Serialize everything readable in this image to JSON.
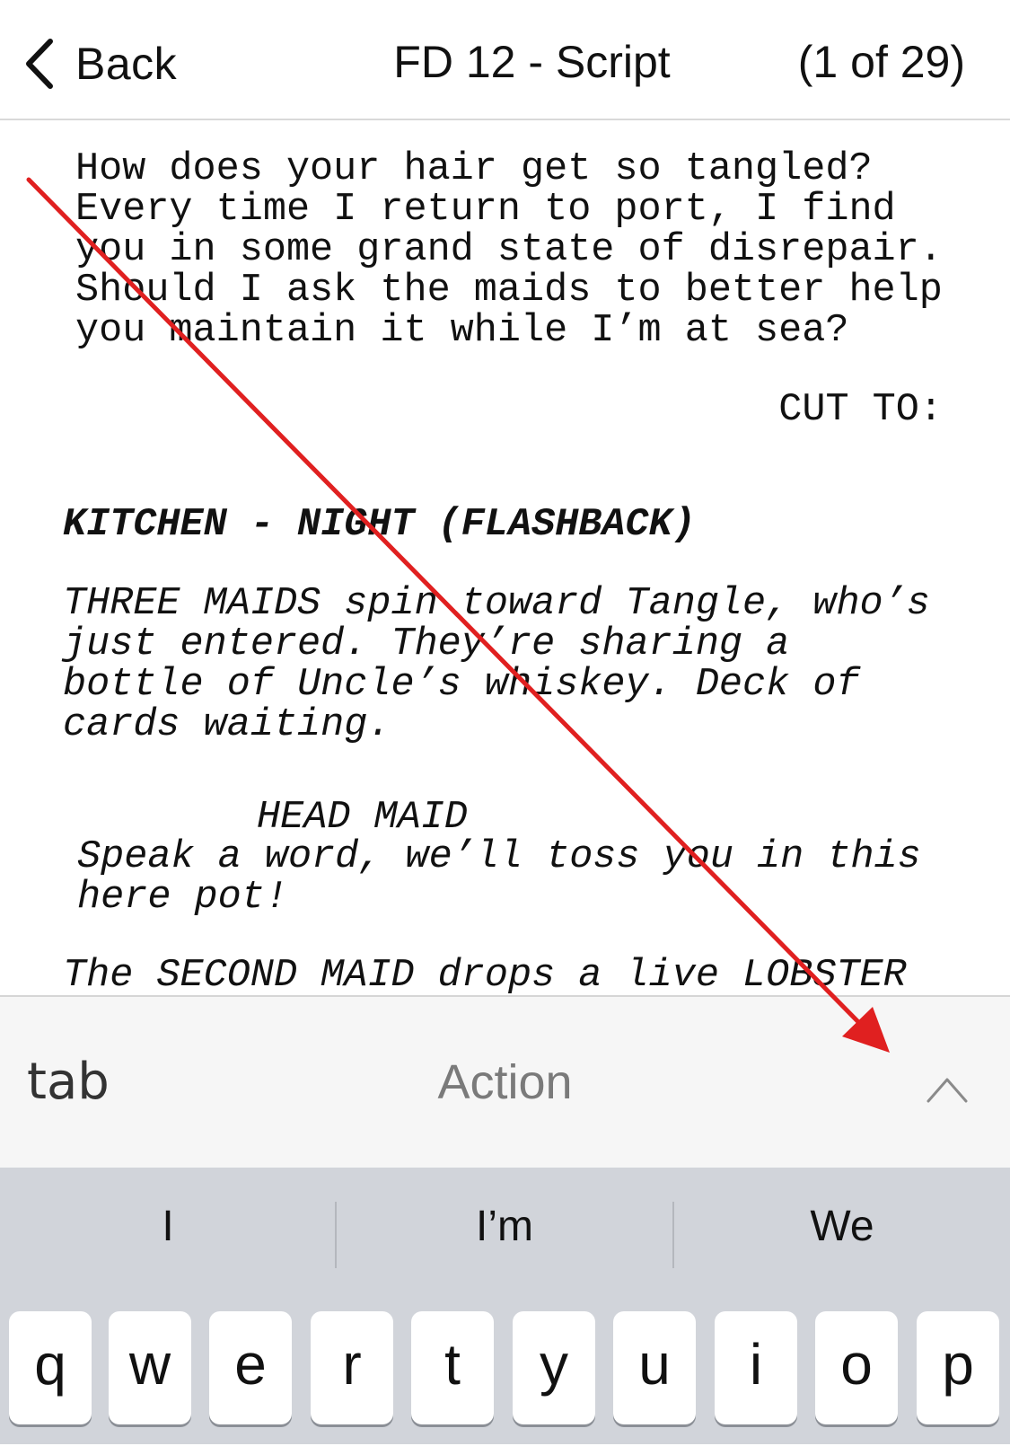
{
  "navbar": {
    "back_label": "Back",
    "title": "FD 12 - Script",
    "page_count": "(1 of 29)"
  },
  "script": {
    "dialogue_1": "How does your hair get so tangled?\nEvery time I return to port, I find\nyou in some grand state of disrepair.\nShould I ask the maids to better help\nyou maintain it while I’m at sea?",
    "transition": "CUT TO:",
    "scene_heading": "KITCHEN - NIGHT (FLASHBACK)",
    "action_1": "THREE MAIDS spin toward Tangle, who’s\njust entered. They’re sharing a\nbottle of Uncle’s whiskey. Deck of\ncards waiting.",
    "character": "HEAD MAID",
    "dialogue_2": "Speak a word, we’ll toss you in this\nhere pot!",
    "action_2": "The SECOND MAID drops a live LOBSTER"
  },
  "element_bar": {
    "tab_label": "tab",
    "current_element": "Action",
    "expand_icon": "chevron-up-icon"
  },
  "keyboard": {
    "suggestions": [
      "I",
      "I’m",
      "We"
    ],
    "keys": [
      "q",
      "w",
      "e",
      "r",
      "t",
      "y",
      "u",
      "i",
      "o",
      "p"
    ]
  },
  "annotation": {
    "color": "#e02020"
  }
}
